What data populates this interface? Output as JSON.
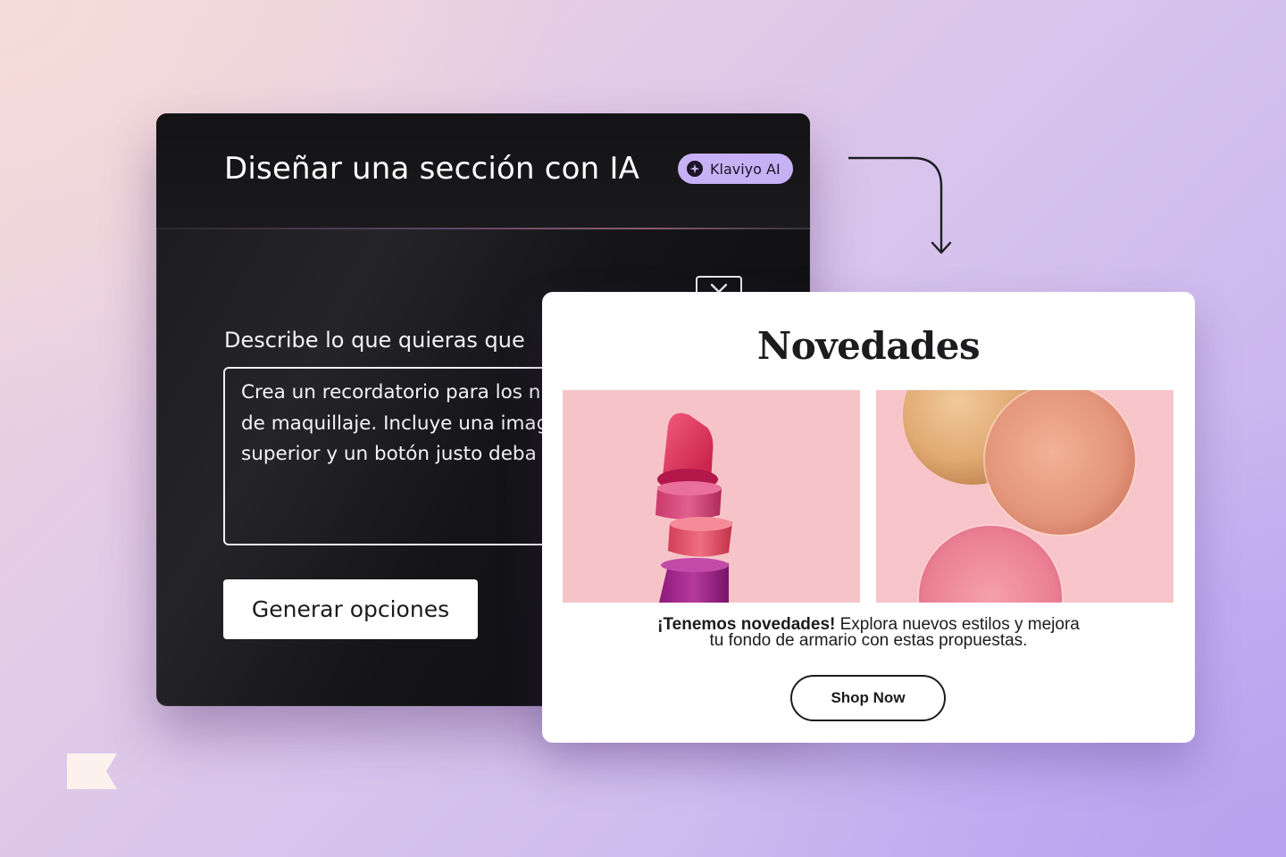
{
  "ai_panel": {
    "title": "Diseñar una sección con IA",
    "badge_label": "Klaviyo AI",
    "prompt_label": "Describe lo que quieras que",
    "prompt_lines": [
      "Crea un recordatorio para los n",
      "de maquillaje. Incluye una imag",
      "superior y un botón justo deba"
    ],
    "generate_label": "Generar opciones"
  },
  "email_preview": {
    "title": "Novedades",
    "body_bold": "¡Tenemos novedades!",
    "body_line1_rest": " Explora nuevos estilos y mejora",
    "body_line2": "tu fondo de armario con estas propuestas.",
    "cta_label": "Shop Now"
  },
  "colors": {
    "badge_bg": "#c7b1f5",
    "panel_bg": "#141416",
    "image_pink": "#f4c3c7"
  },
  "icons": {
    "badge": "sparkle-icon",
    "close": "close-icon",
    "connector": "arrow-down-icon",
    "logo": "klaviyo-flag-icon"
  }
}
